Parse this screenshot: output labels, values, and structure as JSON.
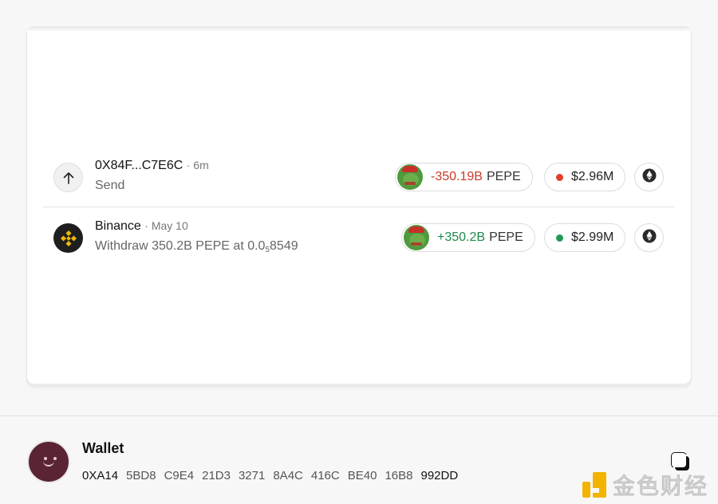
{
  "transactions": [
    {
      "title": "0X84F...C7E6C",
      "time": "· 6m",
      "subtitle": "Send",
      "icon": "arrow-up-icon",
      "amount": "-350.19B",
      "symbol": "PEPE",
      "usd": "$2.96M",
      "usd_dot_color": "#e0402a",
      "amount_color": "#c83a2a",
      "chain_icon": "ethereum-icon"
    },
    {
      "title": "Binance",
      "time": "· May 10",
      "subtitle_main": "Withdraw 350.2B PEPE at 0.0",
      "subtitle_sub": "5",
      "subtitle_tail": "8549",
      "icon": "binance-icon",
      "amount": "+350.2B",
      "symbol": "PEPE",
      "usd": "$2.99M",
      "usd_dot_color": "#1e9a55",
      "amount_color": "#1e8a4c",
      "chain_icon": "ethereum-icon"
    }
  ],
  "wallet": {
    "title": "Wallet",
    "address_parts": [
      "0XA14",
      "5BD8",
      "C9E4",
      "21D3",
      "3271",
      "8A4C",
      "416C",
      "BE40",
      "16B8",
      "992DD"
    ]
  },
  "watermark": {
    "text": "金色财经",
    "brand_color": "#f2b400"
  }
}
